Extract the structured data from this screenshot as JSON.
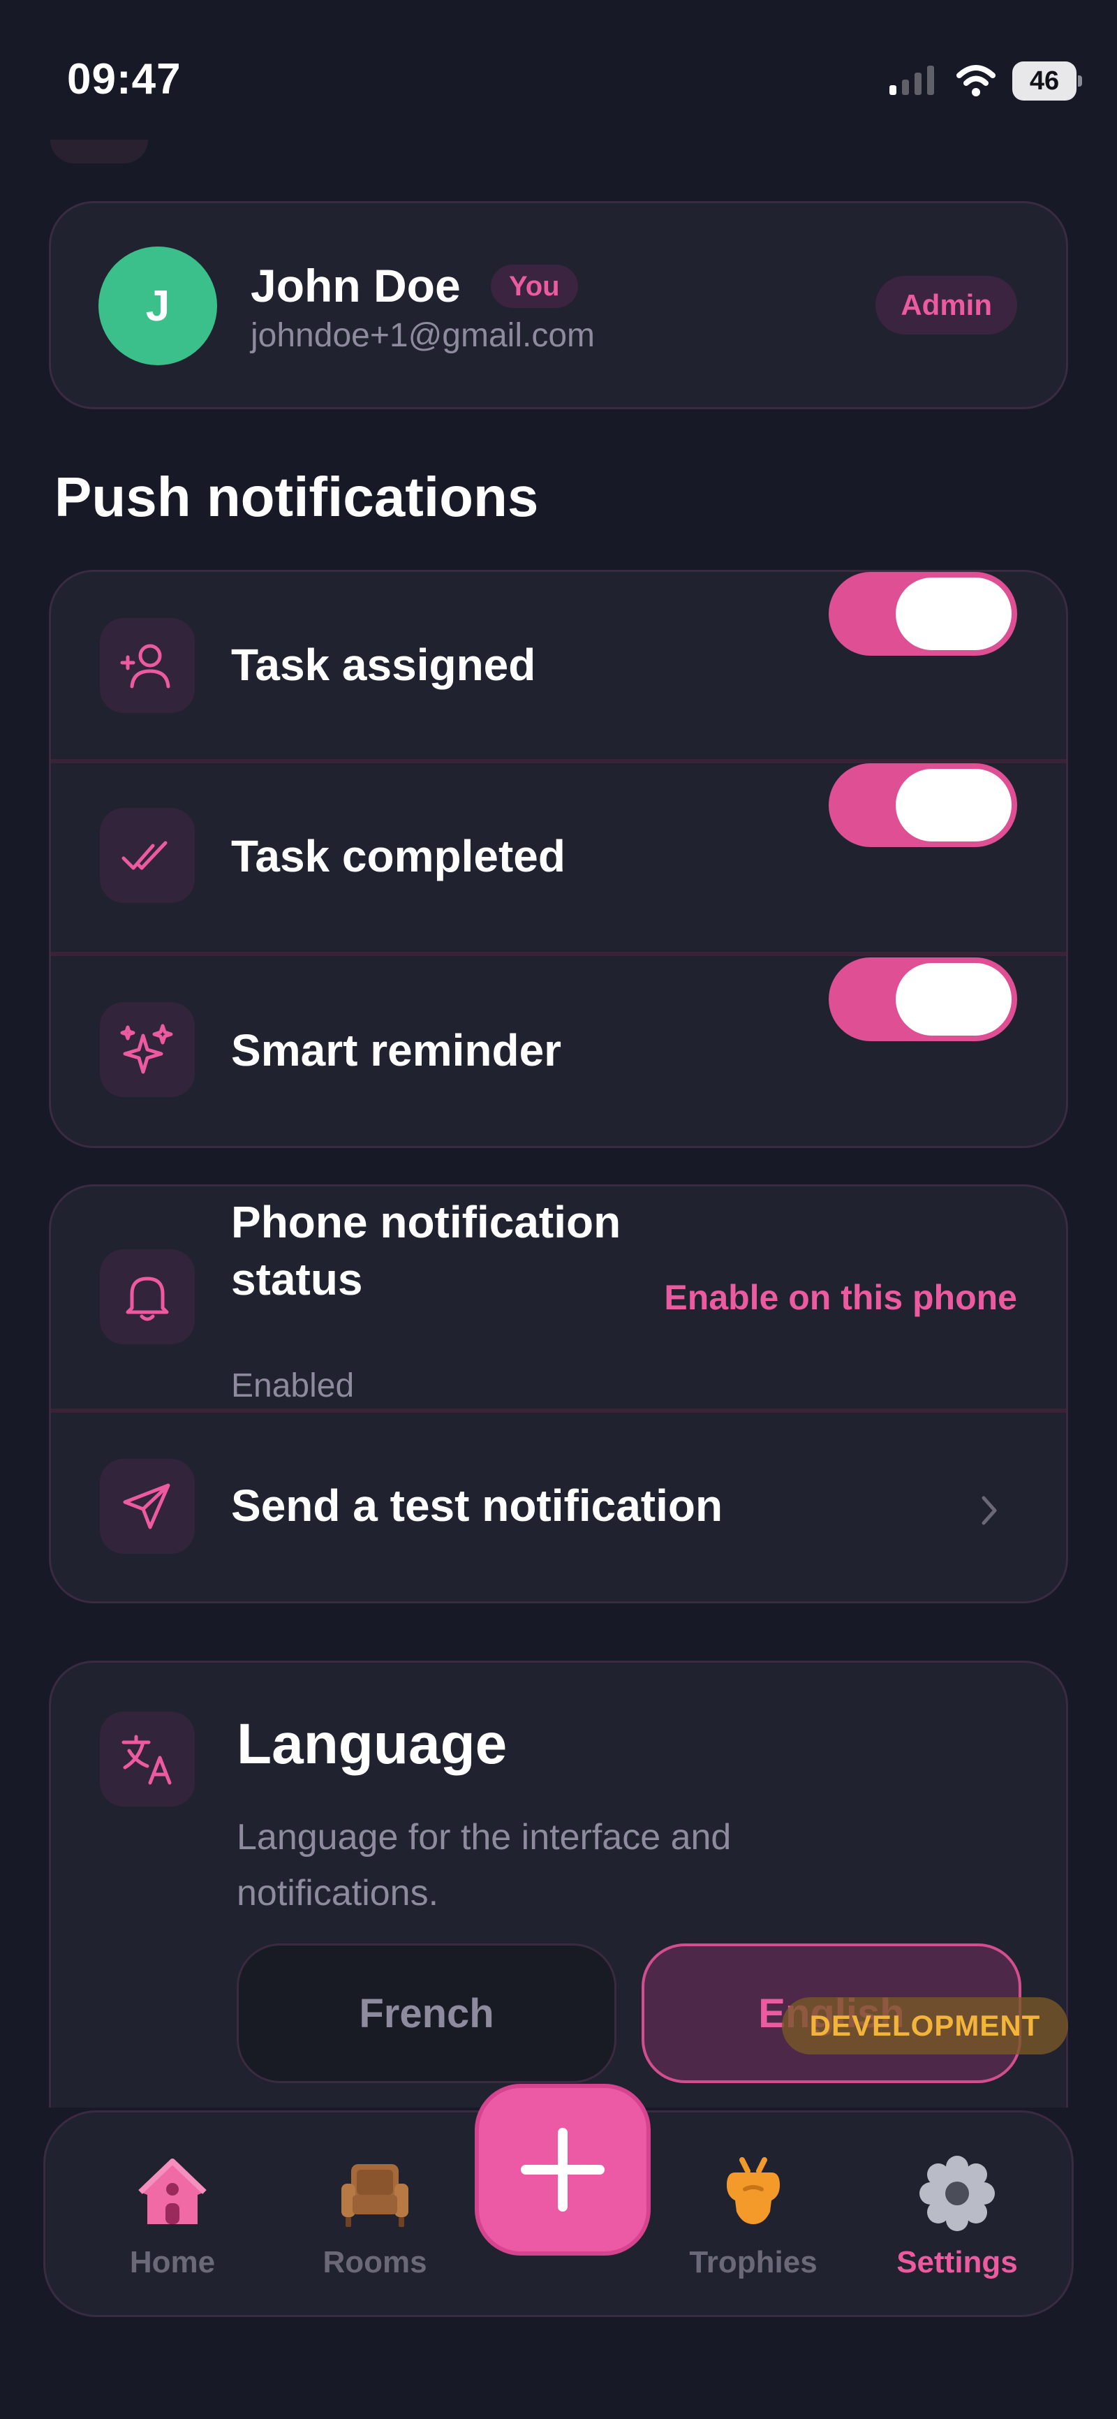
{
  "status_bar": {
    "time": "09:47",
    "battery": "46"
  },
  "profile": {
    "avatar_initial": "J",
    "name": "John Doe",
    "you_badge": "You",
    "email": "johndoe+1@gmail.com",
    "role_badge": "Admin"
  },
  "push_notifications": {
    "title": "Push notifications",
    "items": [
      {
        "label": "Task assigned",
        "icon": "user-plus-icon",
        "enabled": true
      },
      {
        "label": "Task completed",
        "icon": "double-check-icon",
        "enabled": true
      },
      {
        "label": "Smart reminder",
        "icon": "sparkles-icon",
        "enabled": true
      }
    ]
  },
  "phone_notifications": {
    "status_label": "Phone notification status",
    "status_value": "Enabled",
    "enable_link": "Enable on this phone",
    "test_label": "Send a test notification"
  },
  "language": {
    "title": "Language",
    "description": "Language for the interface and notifications.",
    "options": [
      "French",
      "English"
    ],
    "selected": "English"
  },
  "dev_badge": "DEVELOPMENT",
  "nav": {
    "items": [
      {
        "label": "Home",
        "icon": "house-icon",
        "active": false
      },
      {
        "label": "Rooms",
        "icon": "armchair-icon",
        "active": false
      },
      {
        "label": "Trophies",
        "icon": "trophy-icon",
        "active": false
      },
      {
        "label": "Settings",
        "icon": "gear-icon",
        "active": true
      }
    ],
    "fab_icon": "plus-icon"
  },
  "colors": {
    "accent": "#ec5aa0",
    "background": "#171a26",
    "card": "#20222f",
    "avatar": "#3bbf8b",
    "dev_badge": "#f2b43a"
  }
}
